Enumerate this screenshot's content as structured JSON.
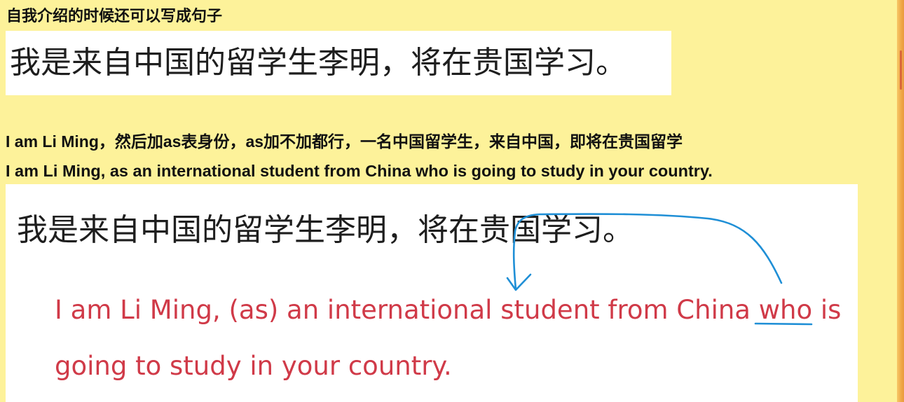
{
  "heading": "自我介绍的时候还可以写成句子",
  "example_sentence_cn": "我是来自中国的留学生李明，将在贵国学习。",
  "explanation": "I am Li Ming，然后加as表身份，as加不加都行，一名中国留学生，来自中国，即将在贵国留学",
  "translation": "I am Li Ming, as an international student from China who is going to study in your country.",
  "annotated_example": {
    "cn": "我是来自中国的留学生李明，将在贵国学习。",
    "en_line_1": "I am Li Ming, (as) an international student from China who is",
    "en_line_2": "going to study in your country.",
    "underlined_word": "who"
  },
  "colors": {
    "background": "#fdf29a",
    "panel": "#ffffff",
    "english_red": "#d03a48",
    "annotation_blue": "#1f8fd6"
  }
}
